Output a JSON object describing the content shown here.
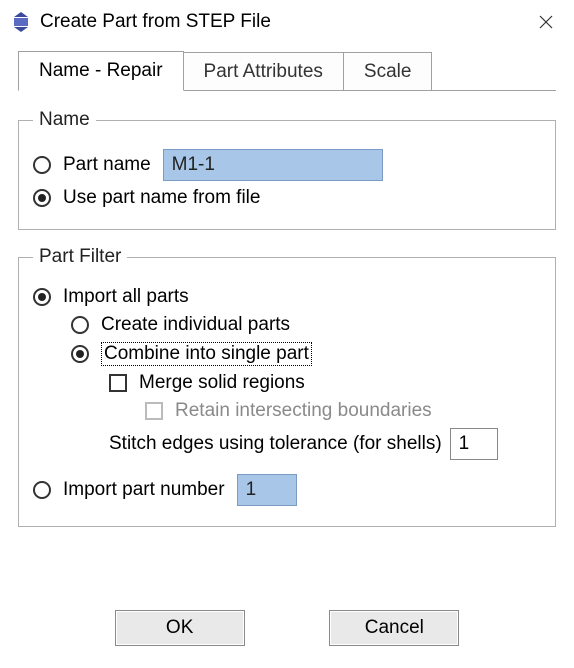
{
  "window": {
    "title": "Create Part from STEP File"
  },
  "tabs": {
    "items": [
      {
        "label": "Name - Repair",
        "active": true
      },
      {
        "label": "Part Attributes",
        "active": false
      },
      {
        "label": "Scale",
        "active": false
      }
    ]
  },
  "name_group": {
    "legend": "Name",
    "part_name_label": "Part name",
    "part_name_value": "M1-1",
    "part_name_selected": false,
    "use_file_label": "Use part name from file",
    "use_file_selected": true
  },
  "filter_group": {
    "legend": "Part Filter",
    "import_all_label": "Import all parts",
    "import_all_selected": true,
    "create_individual_label": "Create individual parts",
    "create_individual_selected": false,
    "combine_label": "Combine into single part",
    "combine_selected": true,
    "merge_label": "Merge solid regions",
    "merge_checked": false,
    "retain_label": "Retain intersecting boundaries",
    "retain_checked": false,
    "retain_enabled": false,
    "stitch_label": "Stitch edges using tolerance (for shells)",
    "stitch_value": "1",
    "import_number_label": "Import part number",
    "import_number_selected": false,
    "import_number_value": "1"
  },
  "buttons": {
    "ok": "OK",
    "cancel": "Cancel"
  }
}
